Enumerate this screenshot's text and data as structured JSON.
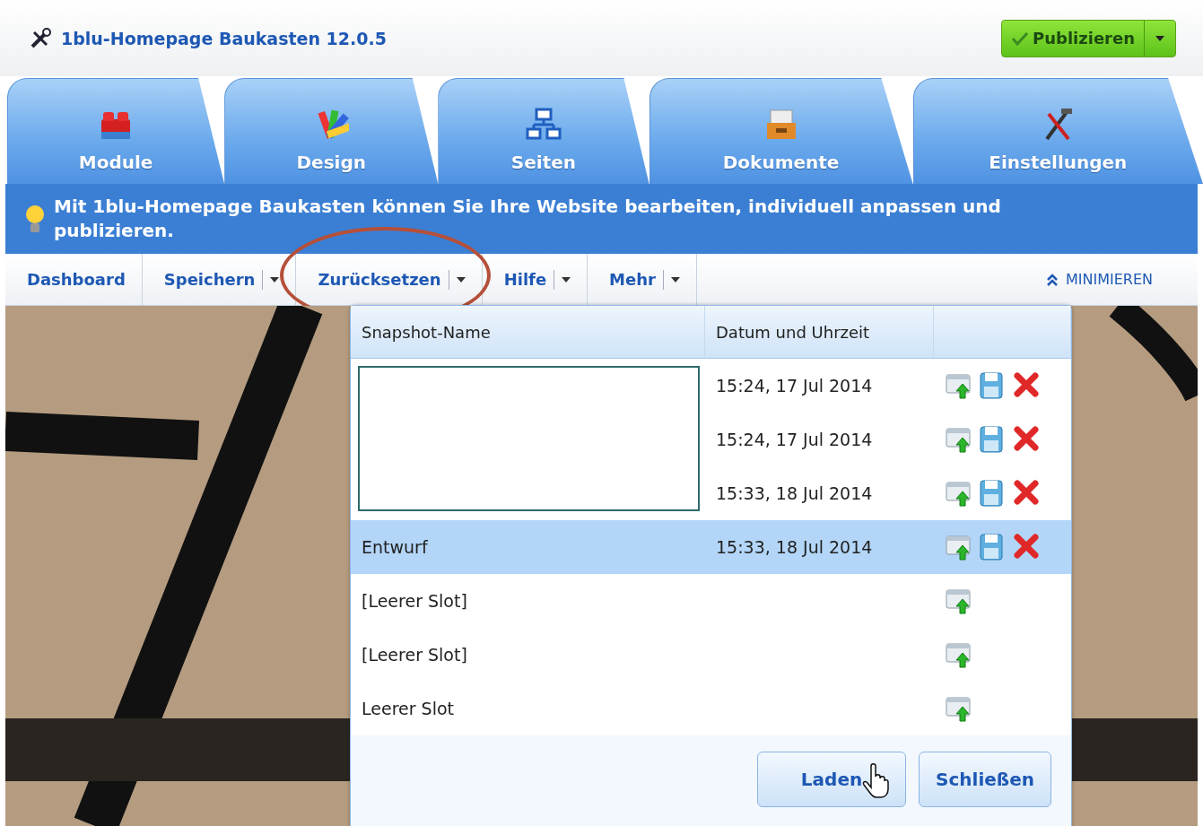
{
  "app": {
    "title": "1blu-Homepage Baukasten 12.0.5",
    "publish_button": "Publizieren"
  },
  "tabs": [
    {
      "label": "Module"
    },
    {
      "label": "Design"
    },
    {
      "label": "Seiten"
    },
    {
      "label": "Dokumente"
    },
    {
      "label": "Einstellungen"
    }
  ],
  "info_bar": {
    "text": "Mit 1blu-Homepage Baukasten können Sie Ihre Website bearbeiten, individuell anpassen und publizieren."
  },
  "toolbar": {
    "items": [
      {
        "label": "Dashboard",
        "dropdown": false,
        "highlighted": false
      },
      {
        "label": "Speichern",
        "dropdown": true,
        "highlighted": false
      },
      {
        "label": "Zurücksetzen",
        "dropdown": true,
        "highlighted": true
      },
      {
        "label": "Hilfe",
        "dropdown": true,
        "highlighted": false
      },
      {
        "label": "Mehr",
        "dropdown": true,
        "highlighted": false
      }
    ],
    "minimize": "MINIMIEREN"
  },
  "snapshot_panel": {
    "columns": [
      "Snapshot-Name",
      "Datum und Uhrzeit"
    ],
    "rows": [
      {
        "kind": "saved",
        "date": "15:24, 17 Jul 2014",
        "selected": false
      },
      {
        "kind": "saved",
        "date": "15:24, 17 Jul 2014",
        "selected": false
      },
      {
        "kind": "saved",
        "date": "15:33, 18 Jul 2014",
        "selected": false
      },
      {
        "kind": "saved",
        "name": "Entwurf",
        "date": "15:33, 18 Jul 2014",
        "selected": true
      },
      {
        "kind": "empty",
        "name": "[Leerer Slot]",
        "selected": false
      },
      {
        "kind": "empty",
        "name": "[Leerer Slot]",
        "selected": false
      },
      {
        "kind": "empty",
        "name": "Leerer Slot",
        "selected": false
      }
    ],
    "buttons": [
      "Laden",
      "Schließen"
    ]
  }
}
